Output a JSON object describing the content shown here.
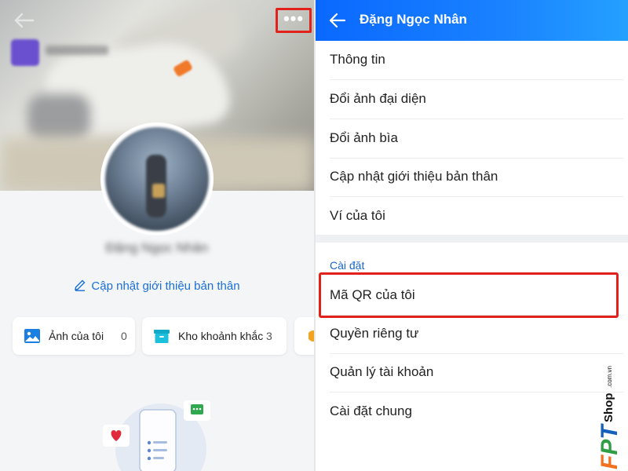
{
  "left_panel": {
    "profile_name": "Đặng Ngọc Nhân",
    "update_intro_label": "Cập nhật giới thiệu bản thân",
    "cards": [
      {
        "label": "Ảnh của tôi",
        "count": "0"
      },
      {
        "label": "Kho khoảnh khắc",
        "count": "3"
      }
    ],
    "more_menu_icon": "more-horizontal-icon",
    "more_menu_text": "•••"
  },
  "right_panel": {
    "header_title": "Đặng Ngọc Nhân",
    "menu_items": [
      "Thông tin",
      "Đổi ảnh đại diện",
      "Đổi ảnh bìa",
      "Cập nhật giới thiệu bản thân",
      "Ví của tôi"
    ],
    "settings_header": "Cài đặt",
    "settings_items": [
      "Mã QR của tôi",
      "Quyền riêng tư",
      "Quản lý tài khoản",
      "Cài đặt chung"
    ]
  },
  "watermark": {
    "brand": "FPT",
    "shop": "Shop",
    "domain": ".com.vn"
  },
  "colors": {
    "header_blue": "#0a68ff",
    "link_blue": "#1a6fd7",
    "highlight_red": "#e2211c"
  }
}
